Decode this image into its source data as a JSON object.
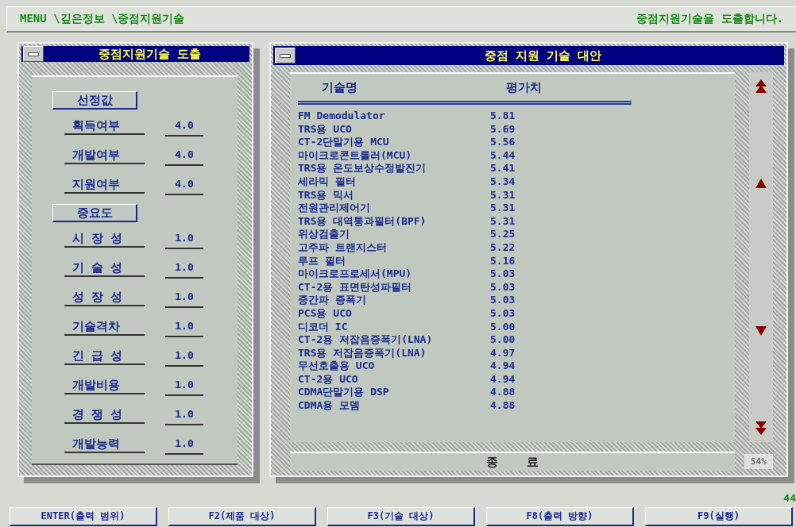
{
  "top_bar": {
    "breadcrumb": "MENU \\깊은정보 \\중점지원기술",
    "message": "중점지원기술을 도출합니다."
  },
  "left_panel": {
    "title": "중점지원기술 도출",
    "sections": [
      {
        "header": "선정값",
        "rows": [
          {
            "label": "획득여부",
            "value": "4.0"
          },
          {
            "label": "개발여부",
            "value": "4.0"
          },
          {
            "label": "지원여부",
            "value": "4.0"
          }
        ]
      },
      {
        "header": "중요도",
        "rows": [
          {
            "label": "시 장 성",
            "value": "1.0"
          },
          {
            "label": "기 술 성",
            "value": "1.0"
          },
          {
            "label": "성 장 성",
            "value": "1.0"
          },
          {
            "label": "기술격차",
            "value": "1.0"
          },
          {
            "label": "긴 급 성",
            "value": "1.0"
          },
          {
            "label": "개발비용",
            "value": "1.0"
          },
          {
            "label": "경 쟁 성",
            "value": "1.0"
          },
          {
            "label": "개발능력",
            "value": "1.0"
          }
        ]
      }
    ]
  },
  "right_panel": {
    "title": "중점 지원 기술 대안",
    "columns": [
      "기술명",
      "평가치"
    ],
    "rows": [
      {
        "name": "FM Demodulator",
        "score": "5.81"
      },
      {
        "name": "TRS용 UCO",
        "score": "5.69"
      },
      {
        "name": "CT-2단말기용 MCU",
        "score": "5.56"
      },
      {
        "name": "마이크로콘트롤러(MCU)",
        "score": "5.44"
      },
      {
        "name": "TRS용 온도보상수정발진기",
        "score": "5.41"
      },
      {
        "name": "세라믹 필터",
        "score": "5.34"
      },
      {
        "name": "TRS용 믹서",
        "score": "5.31"
      },
      {
        "name": "전원관리제어기",
        "score": "5.31"
      },
      {
        "name": "TRS용 대역통과필터(BPF)",
        "score": "5.31"
      },
      {
        "name": "위상검출기",
        "score": "5.25"
      },
      {
        "name": "고주파 트랜지스터",
        "score": "5.22"
      },
      {
        "name": "루프 필터",
        "score": "5.16"
      },
      {
        "name": "마이크로프로세서(MPU)",
        "score": "5.03"
      },
      {
        "name": "CT-2용 표면탄성파필터",
        "score": "5.03"
      },
      {
        "name": "중간파 증폭기",
        "score": "5.03"
      },
      {
        "name": "PCS용 UCO",
        "score": "5.03"
      },
      {
        "name": "디코더 IC",
        "score": "5.00"
      },
      {
        "name": "CT-2용 저잡음증폭기(LNA)",
        "score": "5.00"
      },
      {
        "name": "TRS용 저잡음증폭기(LNA)",
        "score": "4.97"
      },
      {
        "name": "무선호출용 UCO",
        "score": "4.94"
      },
      {
        "name": "CT-2용 UCO",
        "score": "4.94"
      },
      {
        "name": "CDMA단말기용 DSP",
        "score": "4.88"
      },
      {
        "name": "CDMA용 모뎀",
        "score": "4.88"
      }
    ],
    "close_button": "종    료",
    "progress": "54%"
  },
  "counter": "44",
  "function_keys": [
    "ENTER(출력 범위)",
    "F2(제품 대상)",
    "F3(기술 대상)",
    "F8(출력 방향)",
    "F9(실행)"
  ]
}
